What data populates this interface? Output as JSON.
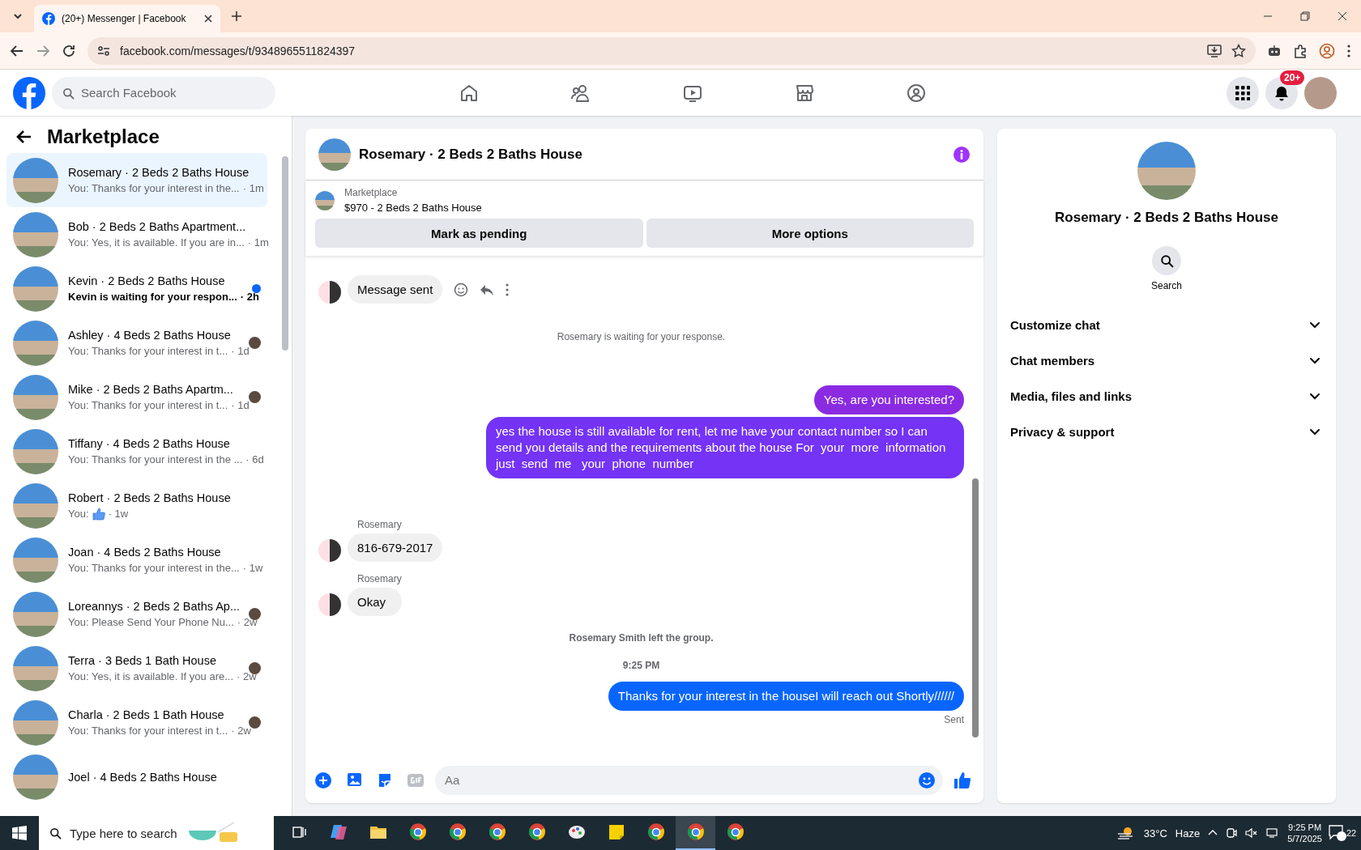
{
  "browser": {
    "tabs": [
      {
        "title": "(20+) Messenger | Facebook",
        "selected": true
      }
    ],
    "url": "facebook.com/messages/t/9348965511824397"
  },
  "header": {
    "search_placeholder": "Search Facebook",
    "nav": [
      {
        "kind": "home"
      },
      {
        "kind": "friends"
      },
      {
        "kind": "video"
      },
      {
        "kind": "marketplace"
      },
      {
        "kind": "groups"
      }
    ],
    "notification_badge": "20+"
  },
  "sidebar": {
    "title": "Marketplace",
    "conversations": [
      {
        "name": "Rosemary · 2 Beds 2 Baths House",
        "preview": "You: Thanks for your interest in the...",
        "time": "· 1m",
        "selected": true,
        "unread": false,
        "seen": false
      },
      {
        "name": "Bob · 2 Beds 2 Baths Apartment...",
        "preview": "You: Yes, it is available. If you are in...",
        "time": "· 1m",
        "selected": false,
        "unread": false,
        "seen": false
      },
      {
        "name": "Kevin · 2 Beds 2 Baths House",
        "preview": "Kevin is waiting for your respon...",
        "time": "· 2h",
        "selected": false,
        "unread": true,
        "seen": false
      },
      {
        "name": "Ashley · 4 Beds 2 Baths House",
        "preview": "You: Thanks for your interest in t...",
        "time": "· 1d",
        "selected": false,
        "unread": false,
        "seen": true
      },
      {
        "name": "Mike · 2 Beds 2 Baths Apartm...",
        "preview": "You: Thanks for your interest in t...",
        "time": "· 1d",
        "selected": false,
        "unread": false,
        "seen": true
      },
      {
        "name": "Tiffany · 4 Beds 2 Baths House",
        "preview": "You: Thanks for your interest in the ...",
        "time": "· 6d",
        "selected": false,
        "unread": false,
        "seen": false
      },
      {
        "name": "Robert · 2 Beds 2 Baths House",
        "preview": "You:",
        "kind": "like",
        "time": "· 1w",
        "selected": false,
        "unread": false,
        "seen": false
      },
      {
        "name": "Joan · 4 Beds 2 Baths House",
        "preview": "You: Thanks for your interest in the...",
        "time": "· 1w",
        "selected": false,
        "unread": false,
        "seen": false
      },
      {
        "name": "Loreannys · 2 Beds 2 Baths Ap...",
        "preview": "You: Please Send Your Phone Nu...",
        "time": "· 2w",
        "selected": false,
        "unread": false,
        "seen": true
      },
      {
        "name": "Terra · 3 Beds 1 Bath House",
        "preview": "You: Yes, it is available. If you are...",
        "time": "· 2w",
        "selected": false,
        "unread": false,
        "seen": true
      },
      {
        "name": "Charla · 2 Beds 1 Bath House",
        "preview": "You: Thanks for your interest in t...",
        "time": "· 2w",
        "selected": false,
        "unread": false,
        "seen": true
      },
      {
        "name": "Joel · 4 Beds 2 Baths House",
        "selected": false
      }
    ]
  },
  "chat": {
    "title": "Rosemary · 2 Beds 2 Baths House",
    "listing_source": "Marketplace",
    "listing": "$970 - 2 Beds 2 Baths House",
    "actions": [
      "Mark as pending",
      "More options"
    ],
    "messages": [
      {
        "kind": "incoming",
        "text": "Message sent",
        "show_actions": true
      },
      {
        "kind": "system",
        "text": "Rosemary is waiting for your response."
      },
      {
        "kind": "outgoing",
        "text": "Yes, are you interested?",
        "color": "#8a2be2"
      },
      {
        "kind": "outgoing",
        "text": "yes the house is still available for rent, let me have your contact number so I can send you details and the requirements about the house For  your  more  information  just  send  me   your  phone  number",
        "color": "#7433f5"
      },
      {
        "kind": "incoming",
        "sender": "Rosemary",
        "text": "816-679-2017",
        "show_actions": false
      },
      {
        "kind": "incoming",
        "sender": "Rosemary",
        "text": "Okay",
        "show_actions": false
      },
      {
        "kind": "system",
        "text": "Rosemary Smith left the group."
      },
      {
        "kind": "timestamp",
        "text": "9:25 PM"
      },
      {
        "kind": "outgoing",
        "text": "Thanks for your interest in the houseI will reach out Shortly//////",
        "color": "#0866ff",
        "status": "Sent"
      }
    ],
    "composer_placeholder": "Aa"
  },
  "info": {
    "title": "Rosemary · 2 Beds 2 Baths House",
    "search_label": "Search",
    "sections": [
      {
        "label": "Customize chat",
        "expanded": false
      },
      {
        "label": "Chat members",
        "expanded": false
      },
      {
        "label": "Media, files and links",
        "expanded": false
      },
      {
        "label": "Privacy & support",
        "expanded": false
      }
    ]
  },
  "taskbar": {
    "search_placeholder": "Type here to search",
    "apps": [
      {
        "kind": "copilot"
      },
      {
        "kind": "folder"
      },
      {
        "kind": "browser"
      },
      {
        "kind": "browser"
      },
      {
        "kind": "browser"
      },
      {
        "kind": "browser"
      },
      {
        "kind": "paint"
      },
      {
        "kind": "notes"
      },
      {
        "kind": "browser"
      },
      {
        "kind": "browser",
        "selected": true
      },
      {
        "kind": "browser"
      }
    ],
    "temperature": "33°C",
    "weather": "Haze",
    "time": "9:25 PM",
    "date": "5/7/2025",
    "notifications": "22"
  }
}
